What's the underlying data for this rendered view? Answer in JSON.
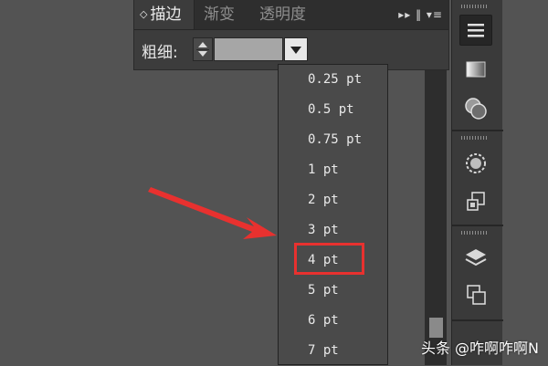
{
  "stroke_panel": {
    "tabs": [
      {
        "label": "描边",
        "active": true
      },
      {
        "label": "渐变",
        "active": false
      },
      {
        "label": "透明度",
        "active": false
      }
    ],
    "menu_icons": "▸▸ ‖ ▾≡",
    "weight_label": "粗细:",
    "weight_value": ""
  },
  "dropdown": {
    "options": [
      "0.25 pt",
      "0.5 pt",
      "0.75 pt",
      "1 pt",
      "2 pt",
      "3 pt",
      "4 pt",
      "5 pt",
      "6 pt",
      "7 pt"
    ],
    "highlighted": "4 pt"
  },
  "toolbar": {
    "icons": [
      "hamburger-menu-icon",
      "gradient-icon",
      "transparency-icon",
      "appearance-icon",
      "symbols-icon",
      "layers-icon",
      "artboards-icon"
    ]
  },
  "colors": {
    "background": "#535353",
    "panel": "#3c3c3c",
    "dropdown": "#4a4a4a",
    "highlight": "#e8312f",
    "arrow": "#e8312f"
  },
  "watermark": "头条 @咋啊咋啊N"
}
